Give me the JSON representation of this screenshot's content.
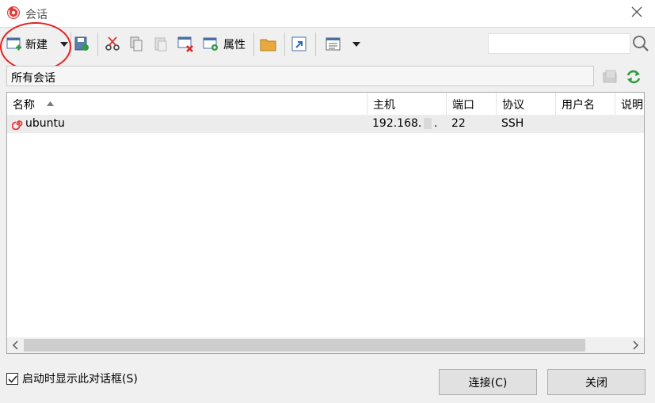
{
  "window": {
    "title": "会话"
  },
  "toolbar": {
    "new_label": "新建",
    "properties_label": "属性"
  },
  "path": {
    "label": "所有会话"
  },
  "table": {
    "columns": [
      "名称",
      "主机",
      "端口",
      "协议",
      "用户名",
      "说明"
    ],
    "rows": [
      {
        "name": "ubuntu",
        "host": "192.168.",
        "host_suffix": ".",
        "port": "22",
        "protocol": "SSH",
        "username": "",
        "description": ""
      }
    ]
  },
  "footer": {
    "show_on_startup_label": "启动时显示此对话框(S)",
    "show_on_startup_checked": true,
    "connect_label": "连接(C)",
    "close_label": "关闭"
  },
  "colors": {
    "accent_red": "#e52222",
    "refresh_green": "#2e9e3e"
  }
}
